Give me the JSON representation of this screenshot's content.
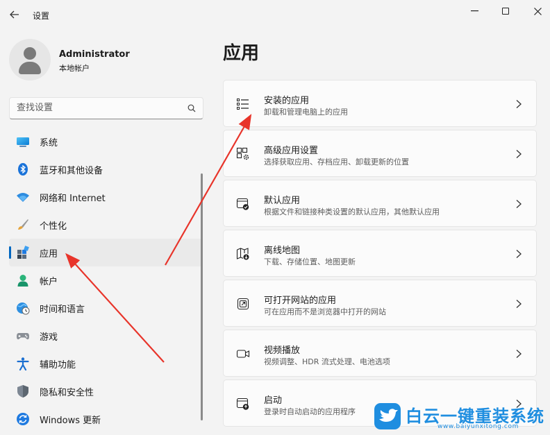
{
  "window": {
    "title": "设置",
    "back_icon": "back-arrow-icon",
    "minimize_icon": "minimize-icon",
    "maximize_icon": "maximize-icon",
    "close_icon": "close-icon"
  },
  "profile": {
    "name": "Administrator",
    "account_type": "本地帐户"
  },
  "search": {
    "placeholder": "查找设置",
    "value": ""
  },
  "nav": {
    "active_index": 4,
    "accent_color": "#0067c0",
    "items": [
      {
        "label": "系统",
        "icon": "monitor-icon"
      },
      {
        "label": "蓝牙和其他设备",
        "icon": "bluetooth-icon"
      },
      {
        "label": "网络和 Internet",
        "icon": "wifi-icon"
      },
      {
        "label": "个性化",
        "icon": "brush-icon"
      },
      {
        "label": "应用",
        "icon": "apps-icon"
      },
      {
        "label": "帐户",
        "icon": "account-icon"
      },
      {
        "label": "时间和语言",
        "icon": "globe-clock-icon"
      },
      {
        "label": "游戏",
        "icon": "gamepad-icon"
      },
      {
        "label": "辅助功能",
        "icon": "accessibility-icon"
      },
      {
        "label": "隐私和安全性",
        "icon": "shield-icon"
      },
      {
        "label": "Windows 更新",
        "icon": "update-icon"
      }
    ]
  },
  "main": {
    "title": "应用",
    "cards": [
      {
        "title": "安装的应用",
        "desc": "卸载和管理电脑上的应用",
        "icon": "installed-apps-icon"
      },
      {
        "title": "高级应用设置",
        "desc": "选择获取应用、存档应用、卸载更新的位置",
        "icon": "advanced-apps-icon"
      },
      {
        "title": "默认应用",
        "desc": "根据文件和链接种类设置的默认应用，其他默认应用",
        "icon": "default-apps-icon"
      },
      {
        "title": "离线地图",
        "desc": "下载、存储位置、地图更新",
        "icon": "offline-map-icon"
      },
      {
        "title": "可打开网站的应用",
        "desc": "可在应用而不是浏览器中打开的网站",
        "icon": "open-website-icon"
      },
      {
        "title": "视频播放",
        "desc": "视频调整、HDR 流式处理、电池选项",
        "icon": "video-camera-icon"
      },
      {
        "title": "启动",
        "desc": "登录时自动启动的应用程序",
        "icon": "startup-icon"
      }
    ]
  },
  "watermark": {
    "text": "白云一键重装系统",
    "url": "www.baiyunxitong.com",
    "color": "#1f8ee0"
  },
  "annotation": {
    "arrow_color": "#e8342a"
  }
}
